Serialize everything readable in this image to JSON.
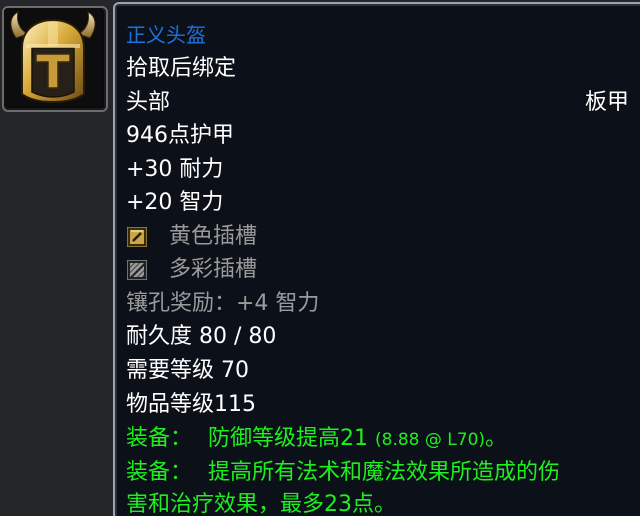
{
  "item": {
    "icon_name": "golden-horned-helmet-icon",
    "name": "正义头盔",
    "binding": "拾取后绑定",
    "slot": "头部",
    "armor_type": "板甲",
    "armor": "946点护甲",
    "stats": [
      "+30 耐力",
      "+20 智力"
    ],
    "sockets": [
      {
        "label": "黄色插槽",
        "icon": "yellow-socket-icon",
        "color": "#c9a648"
      },
      {
        "label": "多彩插槽",
        "icon": "meta-socket-icon",
        "color": "#8a8a8a"
      }
    ],
    "socket_bonus": "镶孔奖励：+4 智力",
    "durability": "耐久度 80 / 80",
    "required_level": "需要等级 70",
    "item_level": "物品等级115",
    "equip_effects": [
      {
        "prefix": "装备：",
        "text": "防御等级提高21 ",
        "note": "(8.88 @ L70)",
        "suffix": "。"
      },
      {
        "prefix": "装备：",
        "text": "提高所有法术和魔法效果所造成的伤",
        "text2": "害和治疗效果，最多23点。"
      }
    ]
  },
  "colors": {
    "item_name": "#1f71e0",
    "white_text": "#ffffff",
    "gray_text": "#9a9a9a",
    "equip_green": "#1ef01e",
    "tooltip_bg": "#0c1119",
    "tooltip_border": "#9ea3ab"
  }
}
